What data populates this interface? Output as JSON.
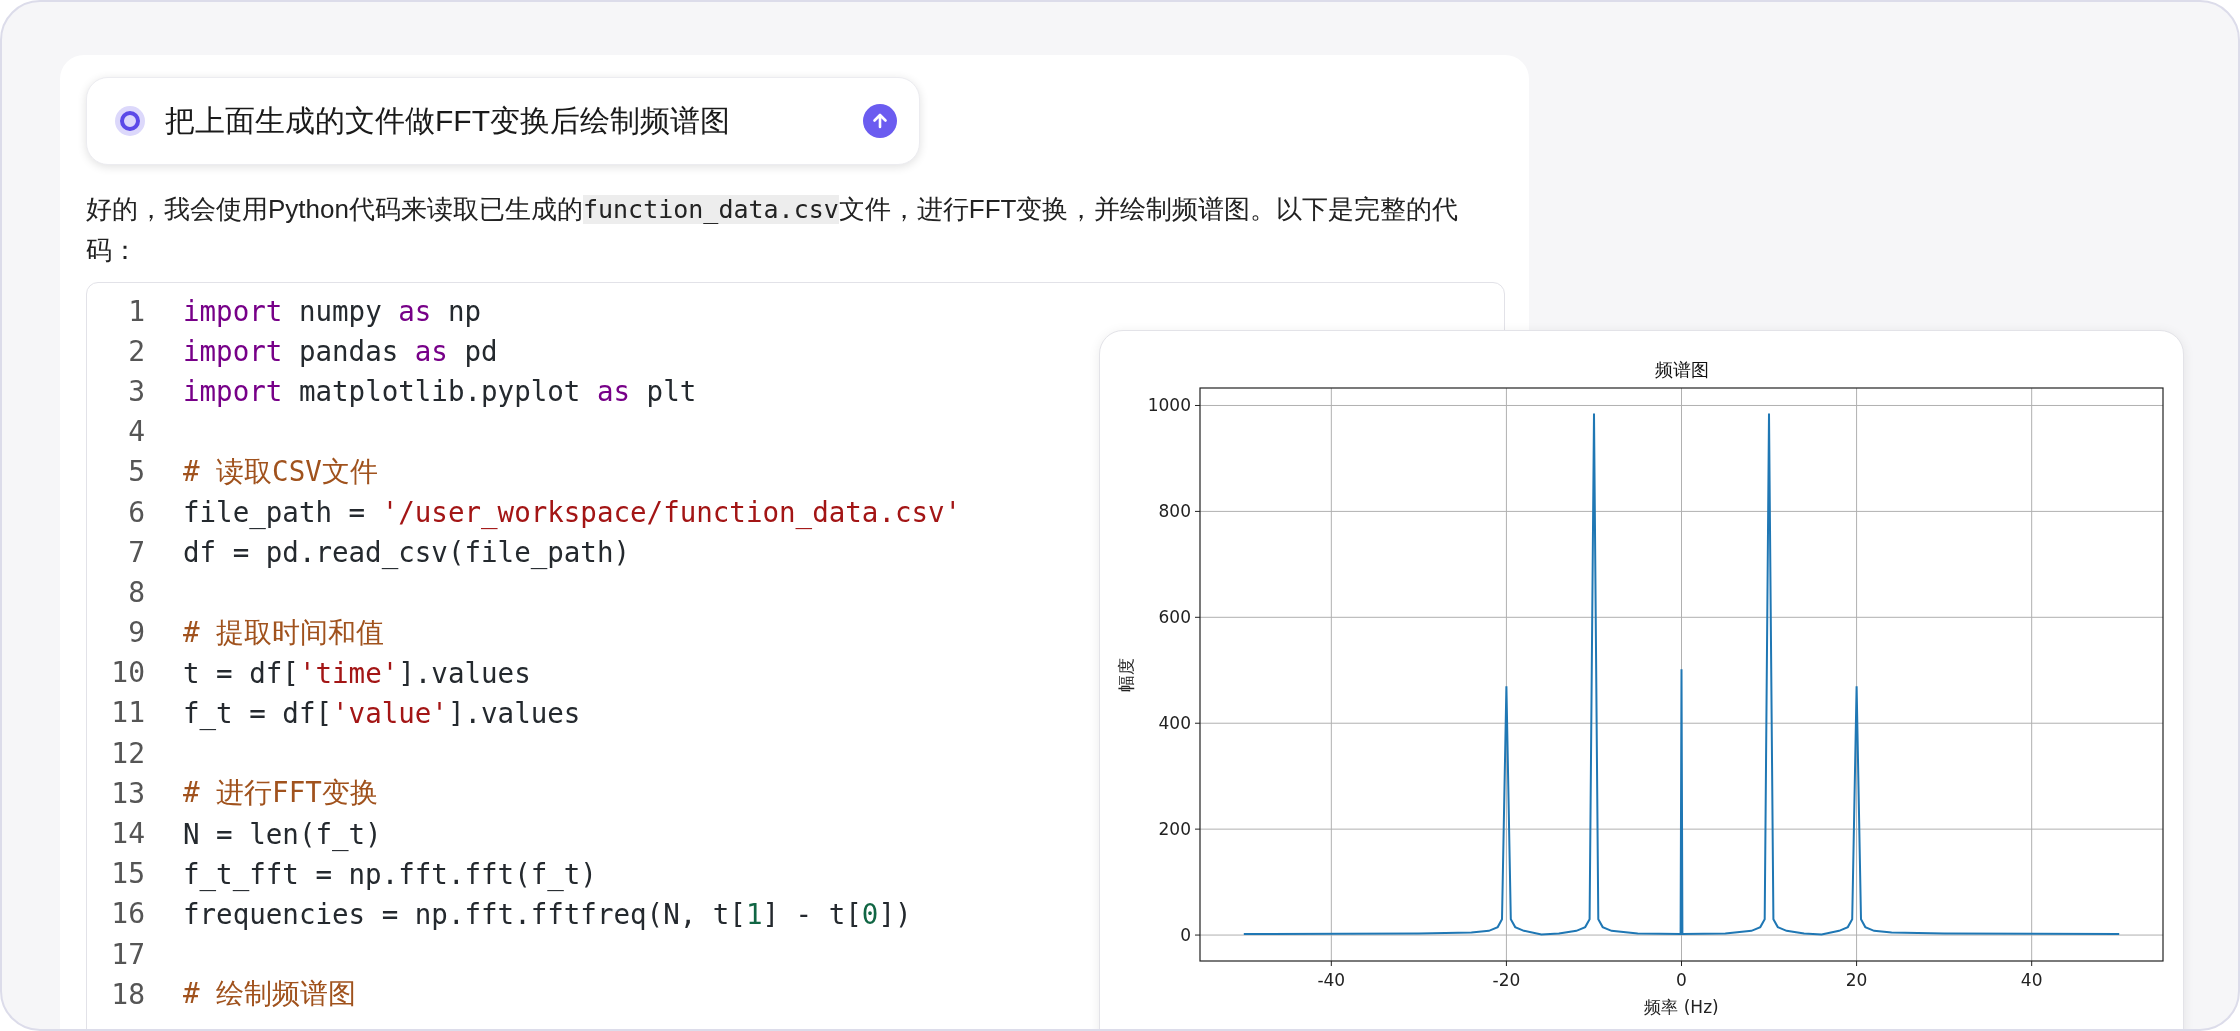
{
  "prompt": {
    "text": "把上面生成的文件做FFT变换后绘制频谱图"
  },
  "reply": {
    "segments": [
      {
        "kind": "text",
        "text": "好的，我会使用Python代码来读取已生成的"
      },
      {
        "kind": "code",
        "text": "function_data.csv"
      },
      {
        "kind": "text",
        "text": "文件，进行FFT变换，并绘制频谱图。以下是完整的代码："
      }
    ]
  },
  "code": {
    "lines": [
      {
        "number": "1",
        "tokens": [
          {
            "kind": "keyword",
            "text": "import"
          },
          {
            "kind": "plain",
            "text": " numpy "
          },
          {
            "kind": "keyword",
            "text": "as"
          },
          {
            "kind": "plain",
            "text": " np"
          }
        ]
      },
      {
        "number": "2",
        "tokens": [
          {
            "kind": "keyword",
            "text": "import"
          },
          {
            "kind": "plain",
            "text": " pandas "
          },
          {
            "kind": "keyword",
            "text": "as"
          },
          {
            "kind": "plain",
            "text": " pd"
          }
        ]
      },
      {
        "number": "3",
        "tokens": [
          {
            "kind": "keyword",
            "text": "import"
          },
          {
            "kind": "plain",
            "text": " matplotlib.pyplot "
          },
          {
            "kind": "keyword",
            "text": "as"
          },
          {
            "kind": "plain",
            "text": " plt"
          }
        ]
      },
      {
        "number": "4"
      },
      {
        "number": "5",
        "tokens": [
          {
            "kind": "comment",
            "text": "# 读取CSV文件"
          }
        ]
      },
      {
        "number": "6",
        "tokens": [
          {
            "kind": "plain",
            "text": "file_path = "
          },
          {
            "kind": "string",
            "text": "'/user_workspace/function_data.csv'"
          }
        ]
      },
      {
        "number": "7",
        "tokens": [
          {
            "kind": "plain",
            "text": "df = pd.read_csv(file_path)"
          }
        ]
      },
      {
        "number": "8"
      },
      {
        "number": "9",
        "tokens": [
          {
            "kind": "comment",
            "text": "# 提取时间和值"
          }
        ]
      },
      {
        "number": "10",
        "tokens": [
          {
            "kind": "plain",
            "text": "t = df["
          },
          {
            "kind": "string",
            "text": "'time'"
          },
          {
            "kind": "plain",
            "text": "].values"
          }
        ]
      },
      {
        "number": "11",
        "tokens": [
          {
            "kind": "plain",
            "text": "f_t = df["
          },
          {
            "kind": "string",
            "text": "'value'"
          },
          {
            "kind": "plain",
            "text": "].values"
          }
        ]
      },
      {
        "number": "12"
      },
      {
        "number": "13",
        "tokens": [
          {
            "kind": "comment",
            "text": "# 进行FFT变换"
          }
        ]
      },
      {
        "number": "14",
        "tokens": [
          {
            "kind": "plain",
            "text": "N = len(f_t)"
          }
        ]
      },
      {
        "number": "15",
        "tokens": [
          {
            "kind": "plain",
            "text": "f_t_fft = np.fft.fft(f_t)"
          }
        ]
      },
      {
        "number": "16",
        "tokens": [
          {
            "kind": "plain",
            "text": "frequencies = np.fft.fftfreq(N, t["
          },
          {
            "kind": "number",
            "text": "1"
          },
          {
            "kind": "plain",
            "text": "] - t["
          },
          {
            "kind": "number",
            "text": "0"
          },
          {
            "kind": "plain",
            "text": "])"
          }
        ]
      },
      {
        "number": "17"
      },
      {
        "number": "18",
        "tokens": [
          {
            "kind": "comment",
            "text": "# 绘制频谱图"
          }
        ]
      }
    ]
  },
  "chart": {
    "chart_data": {
      "type": "line",
      "title": "频谱图",
      "xlabel": "频率 (Hz)",
      "ylabel": "幅度",
      "x": [
        -50,
        -30,
        -24,
        -22,
        -21,
        -20.5,
        -20,
        -19.5,
        -19,
        -18,
        -16,
        -14,
        -12,
        -11,
        -10.5,
        -10,
        -9.5,
        -9,
        -8,
        -5,
        -0.1,
        0,
        0.1,
        5,
        8,
        9,
        9.5,
        10,
        10.5,
        11,
        12,
        14,
        16,
        18,
        19,
        19.5,
        20,
        20.5,
        21,
        22,
        24,
        30,
        50
      ],
      "series": [
        {
          "color": "#1f77b4",
          "values": [
            2,
            3,
            5,
            8,
            15,
            30,
            470,
            30,
            15,
            8,
            1,
            3,
            8,
            15,
            30,
            985,
            30,
            15,
            8,
            3,
            2,
            502,
            2,
            3,
            8,
            15,
            30,
            985,
            30,
            15,
            8,
            3,
            1,
            8,
            15,
            30,
            470,
            30,
            15,
            8,
            5,
            3,
            2
          ]
        }
      ],
      "xlim": [
        -55,
        55
      ],
      "ylim": [
        -49,
        1033
      ],
      "xticks": [
        -40,
        -20,
        0,
        20,
        40
      ],
      "yticks": [
        0,
        200,
        400,
        600,
        800,
        1000
      ],
      "grid": true
    }
  }
}
